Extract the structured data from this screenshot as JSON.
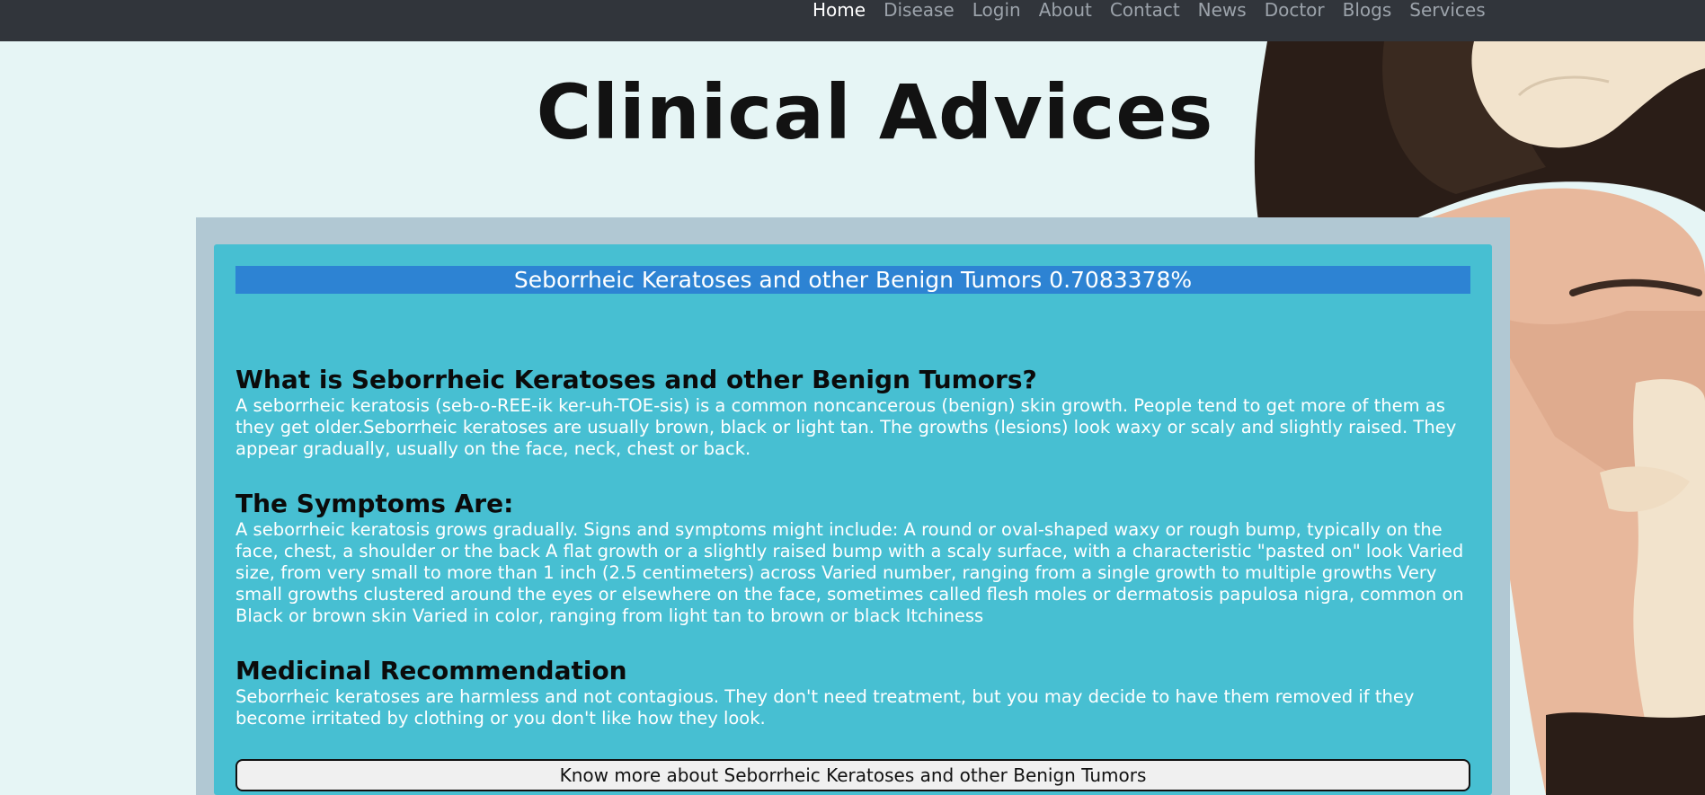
{
  "navbar": {
    "links": [
      {
        "label": "Home",
        "active": true
      },
      {
        "label": "Disease",
        "active": false
      },
      {
        "label": "Login",
        "active": false
      },
      {
        "label": "About",
        "active": false
      },
      {
        "label": "Contact",
        "active": false
      },
      {
        "label": "News",
        "active": false
      },
      {
        "label": "Doctor",
        "active": false
      },
      {
        "label": "Blogs",
        "active": false
      },
      {
        "label": "Services",
        "active": false
      }
    ]
  },
  "page": {
    "title": "Clinical Advices"
  },
  "result": {
    "label": "Seborrheic Keratoses and other Benign Tumors 0.7083378%"
  },
  "sections": {
    "what": {
      "heading": "What is Seborrheic Keratoses and other Benign Tumors?",
      "text": "A seborrheic keratosis (seb-o-REE-ik ker-uh-TOE-sis) is a common noncancerous (benign) skin growth. People tend to get more of them as they get older.Seborrheic keratoses are usually brown, black or light tan. The growths (lesions) look waxy or scaly and slightly raised. They appear gradually, usually on the face, neck, chest or back."
    },
    "symptoms": {
      "heading": "The Symptoms Are:",
      "text": "A seborrheic keratosis grows gradually. Signs and symptoms might include: A round or oval-shaped waxy or rough bump, typically on the face, chest, a shoulder or the back A flat growth or a slightly raised bump with a scaly surface, with a characteristic \"pasted on\" look Varied size, from very small to more than 1 inch (2.5 centimeters) across Varied number, ranging from a single growth to multiple growths Very small growths clustered around the eyes or elsewhere on the face, sometimes called flesh moles or dermatosis papulosa nigra, common on Black or brown skin Varied in color, ranging from light tan to brown or black Itchiness"
    },
    "recommendation": {
      "heading": "Medicinal Recommendation",
      "text": "Seborrheic keratoses are harmless and not contagious. They don't need treatment, but you may decide to have them removed if they become irritated by clothing or you don't like how they look."
    }
  },
  "know_more": {
    "label": "Know more about Seborrheic Keratoses and other Benign Tumors"
  },
  "colors": {
    "navbar_bg": "#31353b",
    "result_bar": "#2d83d3",
    "card_inner": "#47bfd2",
    "card_outer": "#b1c8d3",
    "page_bg": "#e6f5f5"
  }
}
